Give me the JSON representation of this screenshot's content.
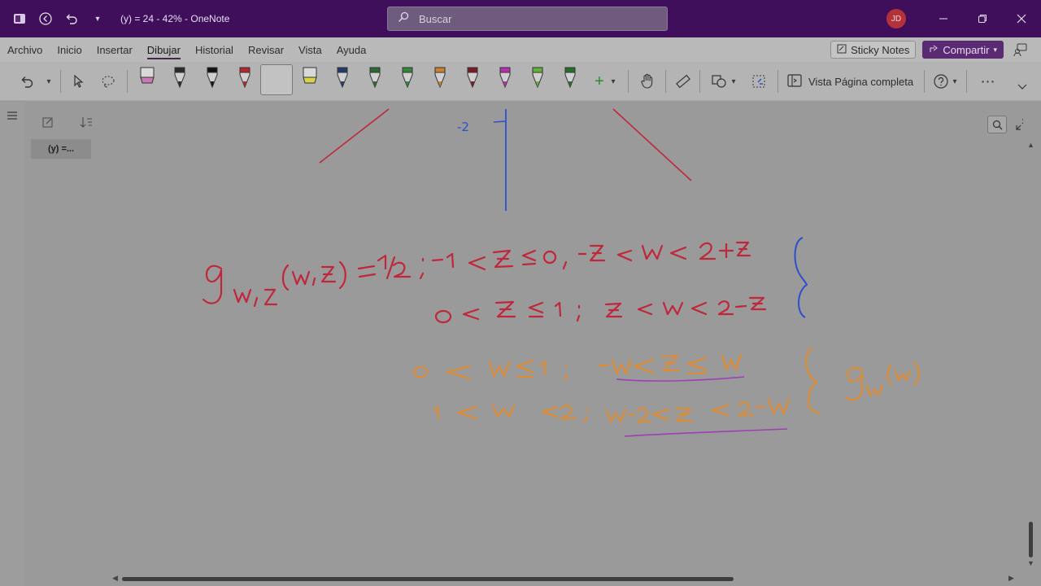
{
  "window": {
    "title": "(y) = 24 - 42%  -  OneNote",
    "search_placeholder": "Buscar",
    "user_initials": "JD"
  },
  "menu": {
    "items": [
      "Archivo",
      "Inicio",
      "Insertar",
      "Dibujar",
      "Historial",
      "Revisar",
      "Vista",
      "Ayuda"
    ],
    "active": "Dibujar",
    "sticky_notes": "Sticky Notes",
    "share": "Compartir"
  },
  "ribbon": {
    "vista_label": "Vista Página completa",
    "pens": [
      {
        "name": "highlighter-pink-pen",
        "color": "#c77ab5"
      },
      {
        "name": "pen-black-outline",
        "color": "#2b2b2b"
      },
      {
        "name": "pen-black",
        "color": "#111111"
      },
      {
        "name": "pen-red",
        "color": "#b8262c"
      },
      {
        "name": "pen-blue",
        "color": "#2d4fbf"
      },
      {
        "name": "highlighter-yellow-pen",
        "color": "#d9d24a"
      },
      {
        "name": "pen-navy",
        "color": "#233a6b"
      },
      {
        "name": "pen-dark-green",
        "color": "#2a6b2f"
      },
      {
        "name": "pen-green",
        "color": "#2f8a36"
      },
      {
        "name": "pen-orange",
        "color": "#c9832d"
      },
      {
        "name": "pen-dark-red",
        "color": "#7a1a24"
      },
      {
        "name": "pen-magenta",
        "color": "#b92fb0"
      },
      {
        "name": "pen-lime-marker",
        "color": "#62b33a"
      },
      {
        "name": "pen-forest",
        "color": "#24702a"
      }
    ]
  },
  "pages": {
    "current": "(y) =..."
  },
  "ink": {
    "red_color": "#c0273a",
    "blue_color": "#2b4fd0",
    "orange_color": "#e08a2c",
    "purple_color": "#9e3fb6",
    "tick_label": "-2"
  }
}
